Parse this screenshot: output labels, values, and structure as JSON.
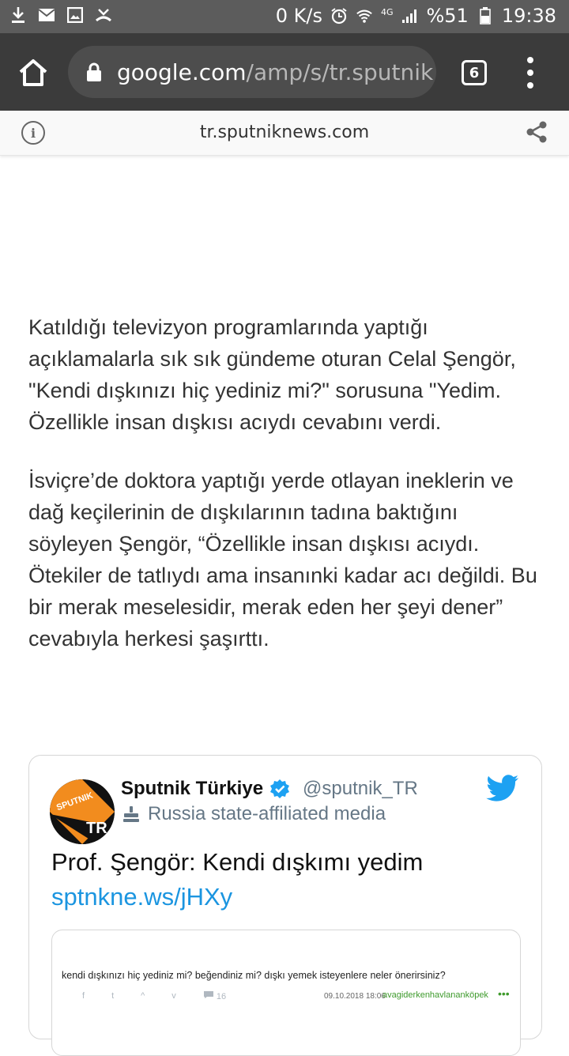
{
  "status_bar": {
    "speed": "0 K/s",
    "network": "4G",
    "battery": "%51",
    "time": "19:38",
    "icons": [
      "download-icon",
      "mail-icon",
      "image-icon",
      "missed-call-icon",
      "alarm-icon",
      "wifi-icon",
      "signal-icon",
      "battery-icon"
    ]
  },
  "browser": {
    "url_main": "google.com",
    "url_rest": "/amp/s/tr.sputnik",
    "tab_count": "6",
    "domain": "tr.sputniknews.com"
  },
  "article": {
    "paragraphs": [
      "Katıldığı televizyon programlarında yaptığı açıklamalarla sık sık gündeme oturan Celal Şengör, \"Kendi dışkınızı hiç yediniz mi?\" sorusuna \"Yedim. Özellikle insan dışkısı acıydı cevabını verdi.",
      "İsviçre’de doktora yaptığı yerde otlayan ineklerin ve dağ keçilerinin de dışkılarının tadına baktığını söyleyen Şengör, “Özellikle insan dışkısı acıydı. Ötekiler de tatlıydı ama insanınki kadar acı değildi. Bu bir merak meselesidir, merak eden her şeyi dener” cevabıyla herkesi şaşırttı."
    ]
  },
  "tweet": {
    "avatar_text_top": "SPUTNIK",
    "avatar_text_bottom": "TR",
    "name": "Sputnik Türkiye",
    "handle": "@sputnik_TR",
    "affiliation": "Russia state-affiliated media",
    "text": "Prof. Şengör: Kendi dışkımı yedim",
    "link": "sptnkne.ws/jHXy",
    "embed": {
      "question": "kendi dışkınızı hiç yediniz mi? beğendiniz mi? dışkı yemek isteyenlere neler önerirsiniz?",
      "meta_f": "f",
      "meta_t": "t",
      "meta_up": "^",
      "meta_down": "v",
      "comment_count": "16",
      "date": "09.10.2018 18:06",
      "user": "avagiderkenhavlananköpek",
      "dots": "•••"
    }
  },
  "colors": {
    "status_bar": "#5c5c5c",
    "toolbar": "#3b3b3b",
    "url_bar": "#4d4d4d",
    "link": "#1b95e0",
    "twitter_blue": "#1da1f2",
    "sputnik_orange": "#f28c1e"
  }
}
